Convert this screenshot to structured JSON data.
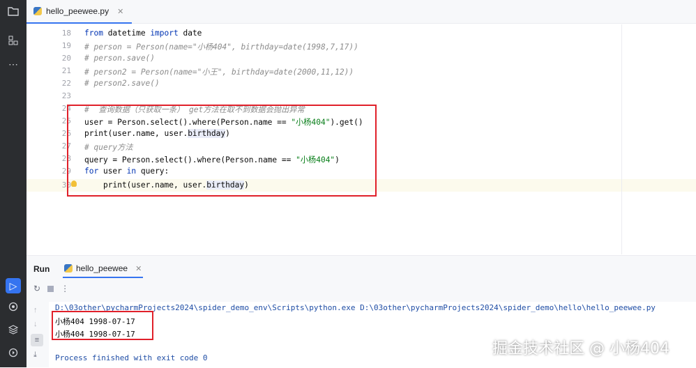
{
  "editor": {
    "tab_label": "hello_peewee.py",
    "line_numbers": [
      "18",
      "19",
      "20",
      "21",
      "22",
      "23",
      "24",
      "25",
      "26",
      "27",
      "28",
      "29",
      "30"
    ],
    "lines": {
      "l18": {
        "kw1": "from",
        "t1": " datetime ",
        "kw2": "import",
        "t2": " date"
      },
      "l19": "# person = Person(name=\"小杨404\", birthday=date(1998,7,17))",
      "l20": "# person.save()",
      "l21": "# person2 = Person(name=\"小王\", birthday=date(2000,11,12))",
      "l22": "# person2.save()",
      "l24": "#  查询数据（只获取一条） get方法在取不到数据会抛出异常",
      "l25": {
        "t1": "user = Person.select().where(Person.name == ",
        "st": "\"小杨404\"",
        "t2": ").get()"
      },
      "l26": {
        "t1": "print(user.name, user.",
        "hl": "birthday",
        "t2": ")"
      },
      "l27": "# query方法",
      "l28": {
        "t1": "query = Person.select().where(Person.name == ",
        "st": "\"小杨404\"",
        "t2": ")"
      },
      "l29": {
        "kw1": "for",
        "t1": " user ",
        "kw2": "in",
        "t2": " query:"
      },
      "l30": {
        "t1": "print(user.name, user.",
        "hl": "birthday",
        "t2": ")"
      }
    }
  },
  "run_panel": {
    "title": "Run",
    "tab_label": "hello_peewee",
    "console": {
      "command": "D:\\03other\\pycharmProjects2024\\spider_demo_env\\Scripts\\python.exe D:\\03other\\pycharmProjects2024\\spider_demo\\hello\\hello_peewee.py",
      "output_lines": [
        "小杨404 1998-07-17",
        "小杨404 1998-07-17"
      ],
      "finished": "Process finished with exit code 0"
    }
  },
  "watermark": "掘金技术社区 @ 小杨404",
  "icons": [
    "folder-icon",
    "structure-icon",
    "more-icon",
    "run-icon",
    "python-console-icon",
    "layers-icon",
    "services-icon",
    "terminal-icon",
    "rerun-icon",
    "stop-icon",
    "menu-icon",
    "up-arrow-icon",
    "down-arrow-icon",
    "wrap-icon",
    "scroll-end-icon",
    "python-file-icon",
    "intention-bulb-icon"
  ],
  "colors": {
    "accent": "#3574f0",
    "annotation_red": "#e0202a",
    "keyword": "#0033b3",
    "string": "#067d17",
    "comment": "#8c8c8c"
  }
}
